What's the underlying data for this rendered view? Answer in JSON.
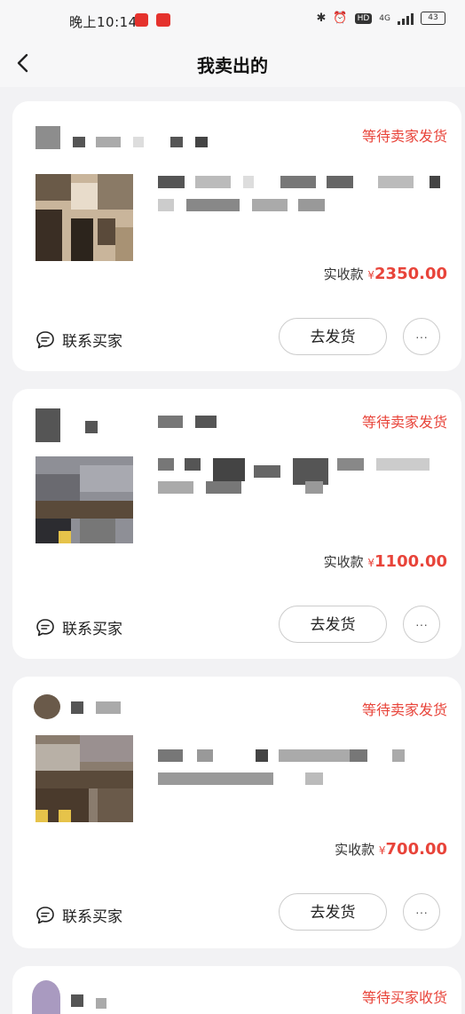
{
  "status_bar": {
    "time": "晚上10:14",
    "network": "4G",
    "battery": "43"
  },
  "header": {
    "title": "我卖出的"
  },
  "orders": [
    {
      "status": "等待卖家发货",
      "amount_label": "实收款",
      "currency": "¥",
      "amount": "2350.00",
      "contact_label": "联系买家",
      "ship_label": "去发货",
      "more_label": "···"
    },
    {
      "status": "等待卖家发货",
      "amount_label": "实收款",
      "currency": "¥",
      "amount": "1100.00",
      "contact_label": "联系买家",
      "ship_label": "去发货",
      "more_label": "···"
    },
    {
      "status": "等待卖家发货",
      "amount_label": "实收款",
      "currency": "¥",
      "amount": "700.00",
      "contact_label": "联系买家",
      "ship_label": "去发货",
      "more_label": "···"
    },
    {
      "status": "等待买家收货"
    }
  ],
  "colors": {
    "accent": "#e8443a",
    "background": "#f2f2f4",
    "card": "#ffffff"
  }
}
